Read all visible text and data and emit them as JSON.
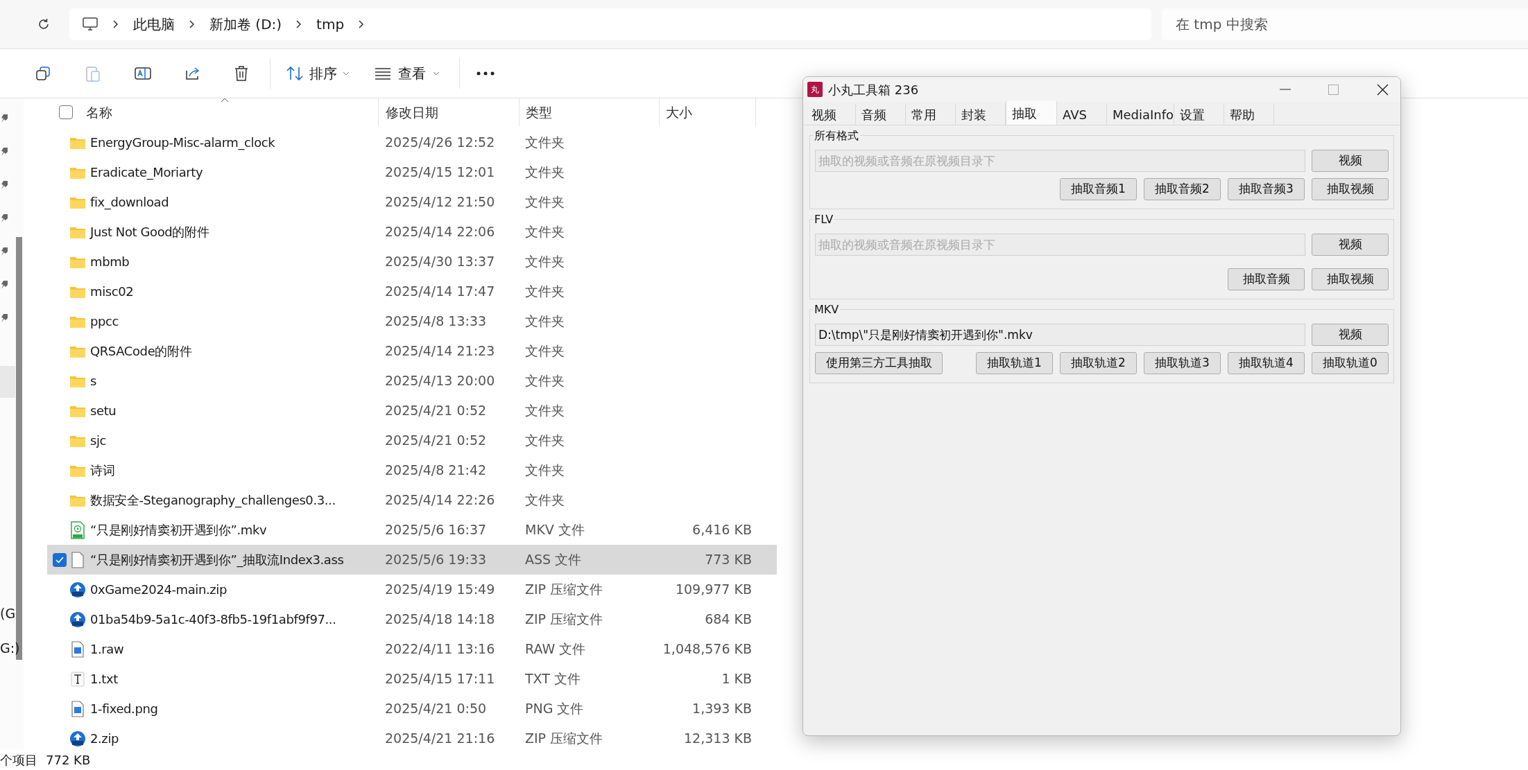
{
  "breadcrumb": [
    "此电脑",
    "新加卷 (D:)",
    "tmp"
  ],
  "search": {
    "placeholder": "在 tmp 中搜索"
  },
  "toolbar": {
    "sort": "排序",
    "view": "查看"
  },
  "nav_pane": {
    "labels": [
      "(G",
      "G:)"
    ]
  },
  "columns": [
    "名称",
    "修改日期",
    "类型",
    "大小"
  ],
  "select_all": {
    "checked": false
  },
  "files": [
    {
      "name": "EnergyGroup-Misc-alarm_clock",
      "date": "2025/4/26 12:52",
      "type": "文件夹",
      "kind": "folder",
      "selected": false
    },
    {
      "name": "Eradicate_Moriarty",
      "date": "2025/4/15 12:01",
      "type": "文件夹",
      "kind": "folder",
      "selected": false
    },
    {
      "name": "fix_download",
      "date": "2025/4/12 21:50",
      "type": "文件夹",
      "kind": "folder",
      "selected": false
    },
    {
      "name": "Just Not Good的附件",
      "date": "2025/4/14 22:06",
      "type": "文件夹",
      "kind": "folder",
      "selected": false
    },
    {
      "name": "mbmb",
      "date": "2025/4/30 13:37",
      "type": "文件夹",
      "kind": "folder",
      "selected": false
    },
    {
      "name": "misc02",
      "date": "2025/4/14 17:47",
      "type": "文件夹",
      "kind": "folder",
      "selected": false
    },
    {
      "name": "ppcc",
      "date": "2025/4/8 13:33",
      "type": "文件夹",
      "kind": "folder",
      "selected": false
    },
    {
      "name": "QRSACode的附件",
      "date": "2025/4/14 21:23",
      "type": "文件夹",
      "kind": "folder",
      "selected": false
    },
    {
      "name": "s",
      "date": "2025/4/13 20:00",
      "type": "文件夹",
      "kind": "folder",
      "selected": false
    },
    {
      "name": "setu",
      "date": "2025/4/21 0:52",
      "type": "文件夹",
      "kind": "folder",
      "selected": false
    },
    {
      "name": "sjc",
      "date": "2025/4/21 0:52",
      "type": "文件夹",
      "kind": "folder",
      "selected": false
    },
    {
      "name": "诗词",
      "date": "2025/4/8 21:42",
      "type": "文件夹",
      "kind": "folder",
      "selected": false
    },
    {
      "name": "数据安全-Steganography_challenges0.3...",
      "date": "2025/4/14 22:26",
      "type": "文件夹",
      "kind": "folder",
      "selected": false
    },
    {
      "name": "“只是刚好情窦初开遇到你”.mkv",
      "date": "2025/5/6 16:37",
      "type": "MKV 文件",
      "size": "6,416 KB",
      "kind": "video",
      "selected": false
    },
    {
      "name": "“只是刚好情窦初开遇到你”_抽取流Index3.ass",
      "date": "2025/5/6 19:33",
      "type": "ASS 文件",
      "size": "773 KB",
      "kind": "doc",
      "selected": true
    },
    {
      "name": "0xGame2024-main.zip",
      "date": "2025/4/19 15:49",
      "type": "ZIP 压缩文件",
      "size": "109,977 KB",
      "kind": "zip",
      "selected": false
    },
    {
      "name": "01ba54b9-5a1c-40f3-8fb5-19f1abf9f97...",
      "date": "2025/4/18 14:18",
      "type": "ZIP 压缩文件",
      "size": "684 KB",
      "kind": "zip",
      "selected": false
    },
    {
      "name": "1.raw",
      "date": "2022/4/11 13:16",
      "type": "RAW 文件",
      "size": "1,048,576 KB",
      "kind": "image",
      "selected": false
    },
    {
      "name": "1.txt",
      "date": "2025/4/15 17:11",
      "type": "TXT 文件",
      "size": "1 KB",
      "kind": "text",
      "selected": false
    },
    {
      "name": "1-fixed.png",
      "date": "2025/4/21 0:50",
      "type": "PNG 文件",
      "size": "1,393 KB",
      "kind": "image",
      "selected": false
    },
    {
      "name": "2.zip",
      "date": "2025/4/21 21:16",
      "type": "ZIP 压缩文件",
      "size": "12,313 KB",
      "kind": "zip",
      "selected": false
    }
  ],
  "status_bar": {
    "count": "个项目",
    "size": "772 KB"
  },
  "dialog": {
    "title": "小丸工具箱 236",
    "logo": "丸",
    "tabs": [
      {
        "label": "视频",
        "selected": false
      },
      {
        "label": "音频",
        "selected": false
      },
      {
        "label": "常用",
        "selected": false
      },
      {
        "label": "封装",
        "selected": false
      },
      {
        "label": "抽取",
        "selected": true
      },
      {
        "label": "AVS",
        "selected": false
      },
      {
        "label": "MediaInfo",
        "selected": false
      },
      {
        "label": "设置",
        "selected": false
      },
      {
        "label": "帮助",
        "selected": false
      }
    ],
    "groups": [
      {
        "title": "所有格式",
        "field": {
          "placeholder": "抽取的视频或音频在原视频目录下"
        },
        "browse": "视频",
        "buttons": [
          "抽取音频1",
          "抽取音频2",
          "抽取音频3",
          "抽取视频"
        ]
      },
      {
        "title": "FLV",
        "field": {
          "placeholder": "抽取的视频或音频在原视频目录下"
        },
        "browse": "视频",
        "buttons": [
          "抽取音频",
          "抽取视频"
        ]
      },
      {
        "title": "MKV",
        "field": {
          "value": "D:\\tmp\\\"只是刚好情窦初开遇到你\".mkv"
        },
        "browse": "视频",
        "left_button": "使用第三方工具抽取",
        "buttons": [
          "抽取轨道1",
          "抽取轨道2",
          "抽取轨道3",
          "抽取轨道4",
          "抽取轨道0"
        ]
      }
    ]
  }
}
